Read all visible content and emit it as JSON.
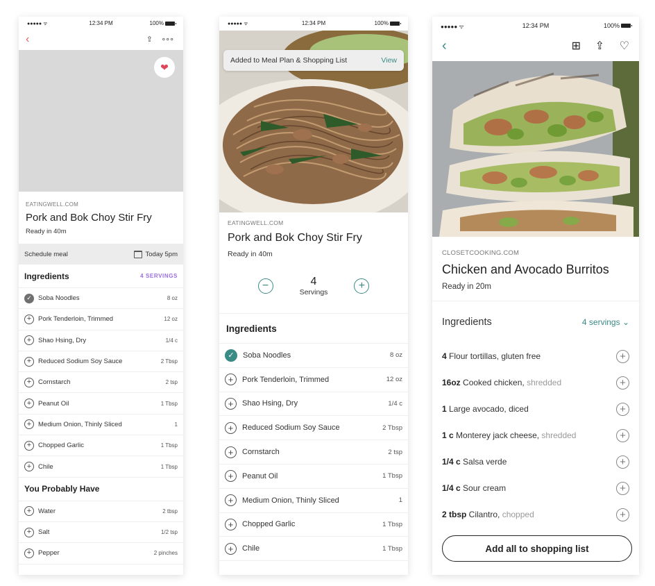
{
  "colors": {
    "accent_teal": "#3a8a86",
    "accent_purple": "#9b6de0",
    "accent_red": "#e05a5a"
  },
  "status": {
    "signal": "●●●●● ᯤ",
    "time": "12:34 PM",
    "battery": "100%"
  },
  "screen1": {
    "source": "EATINGWELL.COM",
    "title": "Pork and Bok Choy Stir Fry",
    "ready": "Ready in 40m",
    "schedule_label": "Schedule meal",
    "schedule_value": "Today 5pm",
    "ingredients_heading": "Ingredients",
    "servings_label": "4 SERVINGS",
    "ingredients": [
      {
        "name": "Soba Noodles",
        "amount": "8 oz",
        "checked": true
      },
      {
        "name": "Pork Tenderloin, Trimmed",
        "amount": "12 oz"
      },
      {
        "name": "Shao Hsing, Dry",
        "amount": "1/4 c"
      },
      {
        "name": "Reduced Sodium Soy Sauce",
        "amount": "2 Tbsp"
      },
      {
        "name": "Cornstarch",
        "amount": "2 tsp"
      },
      {
        "name": "Peanut Oil",
        "amount": "1 Tbsp"
      },
      {
        "name": "Medium Onion, Thinly Sliced",
        "amount": "1"
      },
      {
        "name": "Chopped Garlic",
        "amount": "1 Tbsp"
      },
      {
        "name": "Chile",
        "amount": "1 Tbsp"
      }
    ],
    "pantry_heading": "You Probably Have",
    "pantry": [
      {
        "name": "Water",
        "amount": "2 tbsp"
      },
      {
        "name": "Salt",
        "amount": "1/2 tsp"
      },
      {
        "name": "Pepper",
        "amount": "2 pinches"
      }
    ]
  },
  "screen2": {
    "banner_text": "Added to Meal Plan & Shopping List",
    "banner_action": "View",
    "source": "EATINGWELL.COM",
    "title": "Pork and Bok Choy Stir Fry",
    "ready": "Ready in 40m",
    "servings_count": "4",
    "servings_label": "Servings",
    "ingredients_heading": "Ingredients",
    "ingredients": [
      {
        "name": "Soba Noodles",
        "amount": "8 oz",
        "checked": true
      },
      {
        "name": "Pork Tenderloin, Trimmed",
        "amount": "12 oz"
      },
      {
        "name": "Shao Hsing, Dry",
        "amount": "1/4 c"
      },
      {
        "name": "Reduced Sodium Soy Sauce",
        "amount": "2 Tbsp"
      },
      {
        "name": "Cornstarch",
        "amount": "2 tsp"
      },
      {
        "name": "Peanut Oil",
        "amount": "1 Tbsp"
      },
      {
        "name": "Medium Onion, Thinly Sliced",
        "amount": "1"
      },
      {
        "name": "Chopped Garlic",
        "amount": "1 Tbsp"
      },
      {
        "name": "Chile",
        "amount": "1 Tbsp"
      }
    ]
  },
  "screen3": {
    "source": "CLOSETCOOKING.COM",
    "title": "Chicken and Avocado Burritos",
    "ready": "Ready in 20m",
    "ingredients_heading": "Ingredients",
    "servings_label": "4 servings",
    "ingredients": [
      {
        "qty": "4",
        "name": " Flour tortillas, gluten free",
        "note": ""
      },
      {
        "qty": "16oz",
        "name": " Cooked chicken,",
        "note": " shredded"
      },
      {
        "qty": "1",
        "name": " Large avocado, diced",
        "note": ""
      },
      {
        "qty": "1 c",
        "name": " Monterey jack cheese,",
        "note": " shredded"
      },
      {
        "qty": "1/4 c",
        "name": " Salsa verde",
        "note": ""
      },
      {
        "qty": "1/4 c",
        "name": " Sour cream",
        "note": ""
      },
      {
        "qty": "2 tbsp",
        "name": " Cilantro,",
        "note": " chopped"
      }
    ],
    "add_all_label": "Add all to shopping list"
  }
}
